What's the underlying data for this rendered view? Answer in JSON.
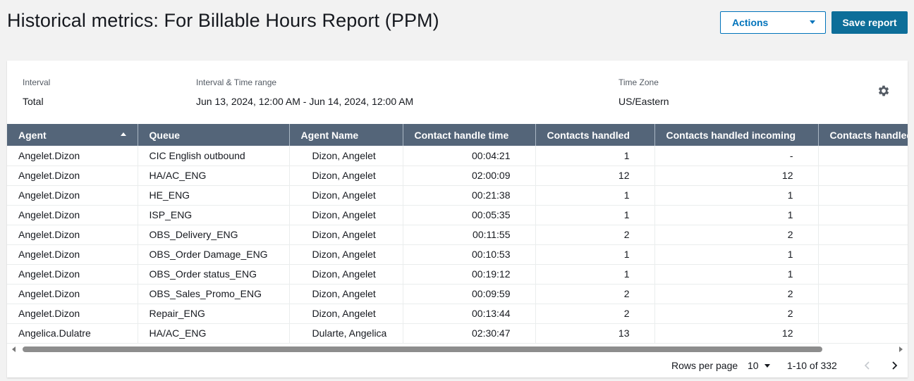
{
  "page": {
    "title": "Historical metrics: For Billable Hours Report (PPM)",
    "actions_label": "Actions",
    "save_label": "Save report"
  },
  "meta": {
    "interval_label": "Interval",
    "interval_value": "Total",
    "range_label": "Interval & Time range",
    "range_value": "Jun 13, 2024, 12:00 AM - Jun 14, 2024, 12:00 AM",
    "tz_label": "Time Zone",
    "tz_value": "US/Eastern"
  },
  "table": {
    "columns": [
      "Agent",
      "Queue",
      "Agent Name",
      "Contact handle time",
      "Contacts handled",
      "Contacts handled incoming",
      "Contacts handled"
    ],
    "sorted_column": "Agent",
    "sort_direction": "ascending",
    "rows": [
      [
        "Angelet.Dizon",
        "CIC English outbound",
        "Dizon, Angelet",
        "00:04:21",
        "1",
        "-"
      ],
      [
        "Angelet.Dizon",
        "HA/AC_ENG",
        "Dizon, Angelet",
        "02:00:09",
        "12",
        "12"
      ],
      [
        "Angelet.Dizon",
        "HE_ENG",
        "Dizon, Angelet",
        "00:21:38",
        "1",
        "1"
      ],
      [
        "Angelet.Dizon",
        "ISP_ENG",
        "Dizon, Angelet",
        "00:05:35",
        "1",
        "1"
      ],
      [
        "Angelet.Dizon",
        "OBS_Delivery_ENG",
        "Dizon, Angelet",
        "00:11:55",
        "2",
        "2"
      ],
      [
        "Angelet.Dizon",
        "OBS_Order Damage_ENG",
        "Dizon, Angelet",
        "00:10:53",
        "1",
        "1"
      ],
      [
        "Angelet.Dizon",
        "OBS_Order status_ENG",
        "Dizon, Angelet",
        "00:19:12",
        "1",
        "1"
      ],
      [
        "Angelet.Dizon",
        "OBS_Sales_Promo_ENG",
        "Dizon, Angelet",
        "00:09:59",
        "2",
        "2"
      ],
      [
        "Angelet.Dizon",
        "Repair_ENG",
        "Dizon, Angelet",
        "00:13:44",
        "2",
        "2"
      ],
      [
        "Angelica.Dulatre",
        "HA/AC_ENG",
        "Dularte, Angelica",
        "02:30:47",
        "13",
        "12"
      ]
    ]
  },
  "pagination": {
    "rows_per_page_label": "Rows per page",
    "rows_per_page_value": "10",
    "range_text": "1-10 of 332"
  },
  "colors": {
    "header_bg": "#546579",
    "primary": "#0d6e99",
    "link": "#0073bb"
  },
  "icons": [
    "settings-gear-icon",
    "sort-ascending-icon",
    "chevron-down-icon",
    "chevron-left-icon",
    "chevron-right-icon"
  ]
}
